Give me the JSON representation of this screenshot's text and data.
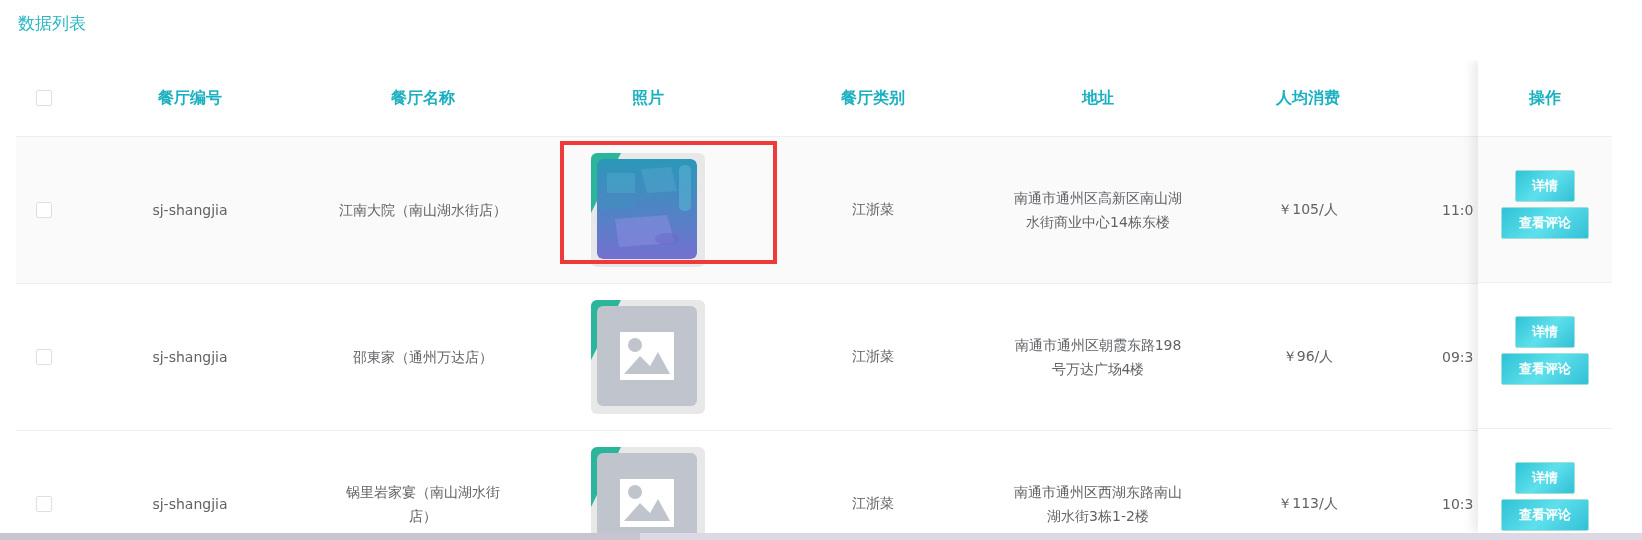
{
  "title": "数据列表",
  "table": {
    "select_all": {
      "checked": false
    },
    "columns": [
      "餐厅编号",
      "餐厅名称",
      "照片",
      "餐厅类别",
      "地址",
      "人均消费"
    ],
    "fixed_column": "操作",
    "rows": [
      {
        "checked": false,
        "id": "sj-shangjia",
        "name": "江南大院（南山湖水街店）",
        "photo": {
          "kind": "picture",
          "highlighted": true
        },
        "category": "江浙菜",
        "address": "南通市通州区高新区南山湖水街商业中心14栋东楼",
        "price": "￥105/人",
        "column_8": "11:0",
        "actions": [
          "详情",
          "查看评论"
        ]
      },
      {
        "checked": false,
        "id": "sj-shangjia",
        "name": "邵東家（通州万达店）",
        "photo": {
          "kind": "placeholder",
          "highlighted": false
        },
        "category": "江浙菜",
        "address": "南通市通州区朝霞东路198号万达广场4楼",
        "price": "￥96/人",
        "column_8": "09:3",
        "actions": [
          "详情",
          "查看评论"
        ]
      },
      {
        "checked": false,
        "id": "sj-shangjia",
        "name": "锅里岩家宴（南山湖水街店）",
        "photo": {
          "kind": "placeholder",
          "highlighted": false
        },
        "category": "江浙菜",
        "address": "南通市通州区西湖东路南山湖水街3栋1-2楼",
        "price": "￥113/人",
        "column_8": "10:3",
        "actions": [
          "详情",
          "查看评论"
        ]
      }
    ]
  }
}
